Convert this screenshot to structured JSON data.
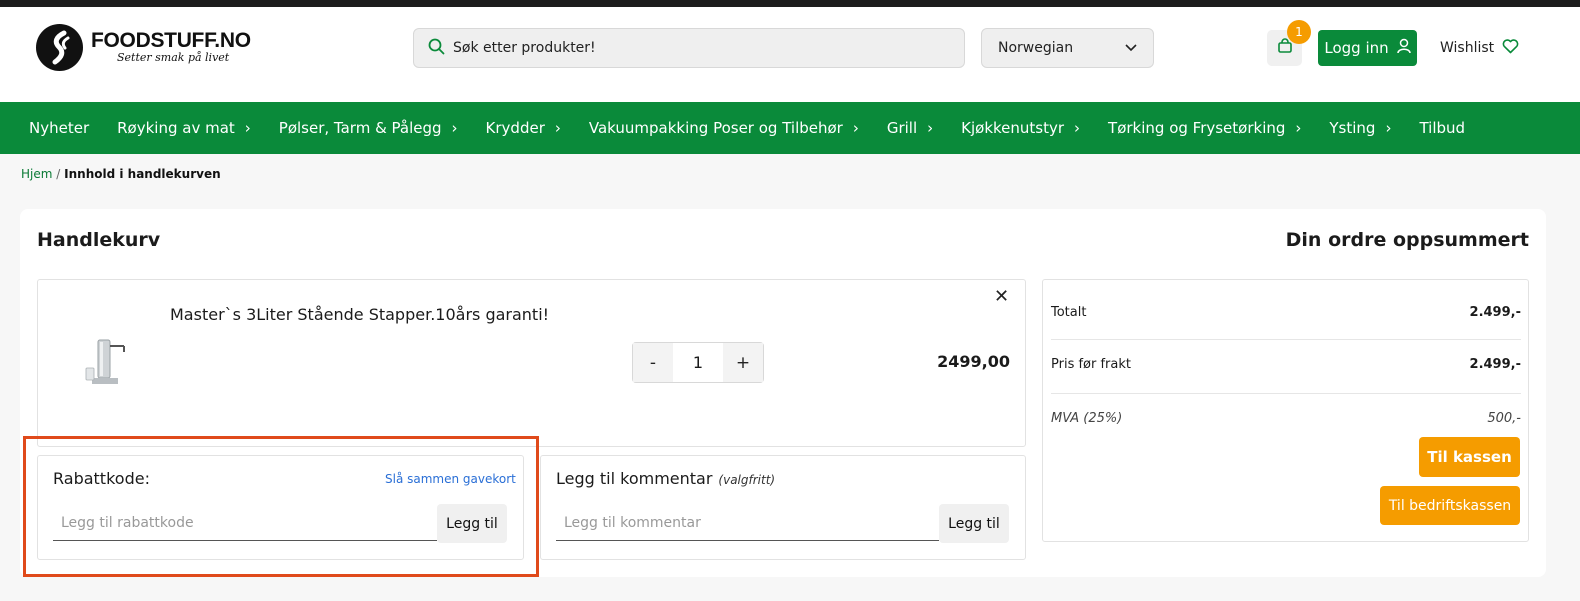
{
  "header": {
    "logo_name": "FOODSTUFF.NO",
    "logo_tagline": "Setter smak på livet",
    "search_placeholder": "Søk etter produkter!",
    "language": "Norwegian",
    "cart_count": "1",
    "login_label": "Logg inn",
    "wishlist_label": "Wishlist"
  },
  "nav": {
    "items": [
      {
        "label": "Nyheter",
        "has_chevron": false
      },
      {
        "label": "Røyking av mat",
        "has_chevron": true
      },
      {
        "label": "Pølser, Tarm & Pålegg",
        "has_chevron": true
      },
      {
        "label": "Krydder",
        "has_chevron": true
      },
      {
        "label": "Vakuumpakking Poser og Tilbehør",
        "has_chevron": true
      },
      {
        "label": "Grill",
        "has_chevron": true
      },
      {
        "label": "Kjøkkenutstyr",
        "has_chevron": true
      },
      {
        "label": "Tørking og Frysetørking",
        "has_chevron": true
      },
      {
        "label": "Ysting",
        "has_chevron": true
      },
      {
        "label": "Tilbud",
        "has_chevron": false
      }
    ]
  },
  "breadcrumb": {
    "home": "Hjem",
    "separator": "/",
    "current": "Innhold i handlekurven"
  },
  "cart": {
    "title": "Handlekurv",
    "item": {
      "name": "Master`s 3Liter Stående Stapper.10års garanti!",
      "quantity": "1",
      "minus": "-",
      "plus": "+",
      "price": "2499,00",
      "remove": "✕"
    },
    "discount": {
      "label": "Rabattkode:",
      "gift_link": "Slå sammen gavekort",
      "placeholder": "Legg til rabattkode",
      "button": "Legg til"
    },
    "comment": {
      "label": "Legg til kommentar",
      "optional": "(valgfritt)",
      "placeholder": "Legg til kommentar",
      "button": "Legg til"
    }
  },
  "summary": {
    "title": "Din ordre oppsummert",
    "total_label": "Totalt",
    "total_value": "2.499,-",
    "pre_shipping_label": "Pris før frakt",
    "pre_shipping_value": "2.499,-",
    "vat_label": "MVA (25%)",
    "vat_value": "500,-",
    "checkout_button": "Til kassen",
    "business_checkout_button": "Til bedriftskassen"
  },
  "colors": {
    "brand_green": "#0a8a3a",
    "accent_orange": "#f59c00",
    "highlight_red": "#e04a1b",
    "link_blue": "#2a6fd6"
  }
}
